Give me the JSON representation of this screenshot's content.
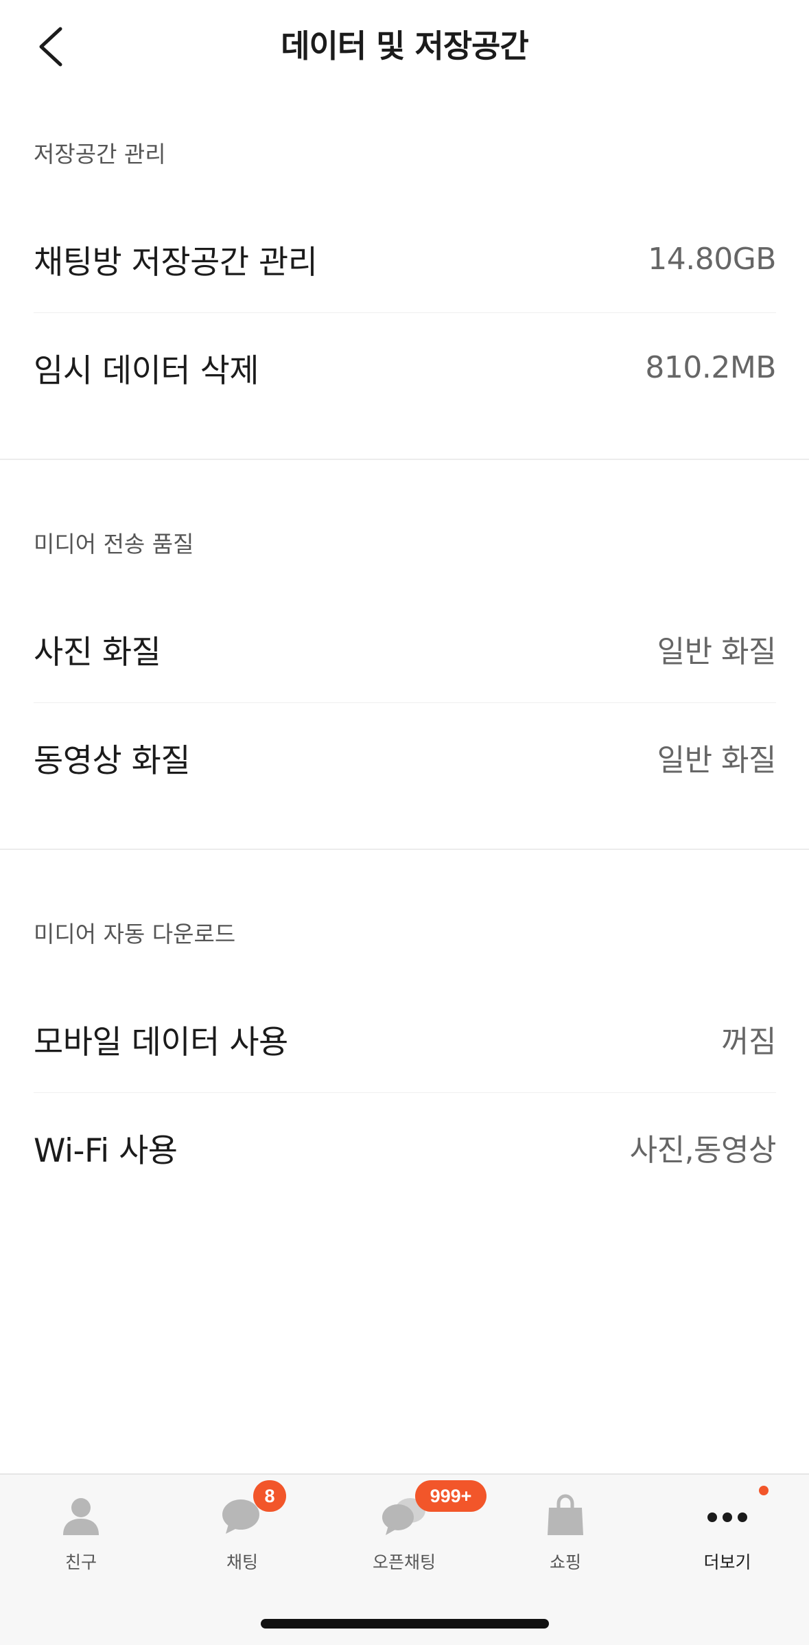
{
  "header": {
    "title": "데이터 및 저장공간",
    "back_icon": "chevron-left-icon"
  },
  "sections": [
    {
      "title": "저장공간 관리",
      "rows": [
        {
          "label": "채팅방 저장공간 관리",
          "value": "14.80GB"
        },
        {
          "label": "임시 데이터 삭제",
          "value": "810.2MB"
        }
      ]
    },
    {
      "title": "미디어 전송 품질",
      "rows": [
        {
          "label": "사진 화질",
          "value": "일반 화질"
        },
        {
          "label": "동영상 화질",
          "value": "일반 화질"
        }
      ]
    },
    {
      "title": "미디어 자동 다운로드",
      "rows": [
        {
          "label": "모바일 데이터 사용",
          "value": "꺼짐"
        },
        {
          "label": "Wi-Fi 사용",
          "value": "사진,동영상"
        }
      ]
    }
  ],
  "tabbar": {
    "tabs": [
      {
        "label": "친구",
        "icon": "person-icon"
      },
      {
        "label": "채팅",
        "icon": "chat-bubble-icon",
        "badge": "8"
      },
      {
        "label": "오픈채팅",
        "icon": "open-chat-icon",
        "badge": "999+"
      },
      {
        "label": "쇼핑",
        "icon": "shopping-bag-icon"
      },
      {
        "label": "더보기",
        "icon": "more-dots-icon",
        "active": true
      }
    ]
  },
  "colors": {
    "accent_badge": "#f2562a",
    "icon_gray": "#b7b7b7",
    "active_icon": "#1b1b1b"
  }
}
